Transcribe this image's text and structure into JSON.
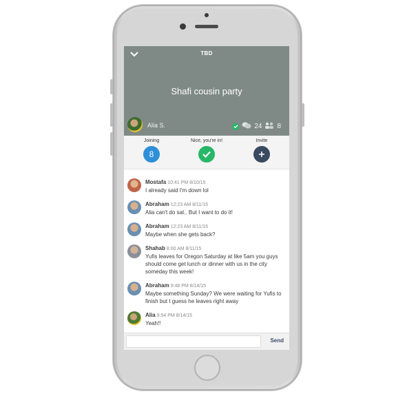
{
  "header": {
    "title": "TBD",
    "event_name": "Shafi cousin party",
    "host_name": "Alia S.",
    "comment_count": "24",
    "people_count": "8"
  },
  "actions": [
    {
      "label": "Joining",
      "value": "8",
      "color": "#2f8fd8"
    },
    {
      "label": "Nice, you're in!",
      "color": "#27b768",
      "icon": "check-icon"
    },
    {
      "label": "Invite",
      "color": "#3a4a5f",
      "icon": "plus-icon"
    }
  ],
  "messages": [
    {
      "name": "Mostafa",
      "time": "10:41 PM 8/10/15",
      "text": "I already said I'm down lol",
      "avatar_color": "#c0654a"
    },
    {
      "name": "Abraham",
      "time": "12:23 AM 8/11/15",
      "text": "Alia can't do sat.. But I want to do it!",
      "avatar_color": "#6a8fb3"
    },
    {
      "name": "Abraham",
      "time": "12:23 AM 8/11/15",
      "text": "Maybe when she gets back?",
      "avatar_color": "#6a8fb3"
    },
    {
      "name": "Shahab",
      "time": "8:00 AM 8/11/15",
      "text": "Yufis leaves for Oregon Saturday at like 5am you guys should come get lunch or dinner with us in the city someday this week!",
      "avatar_color": "#8a8f99"
    },
    {
      "name": "Abraham",
      "time": "9:48 PM 8/14/15",
      "text": "Maybe something Sunday? We were waiting for Yufis to finish but I guess he leaves right away",
      "avatar_color": "#6a8fb3"
    },
    {
      "name": "Alia",
      "time": "9:54 PM 8/14/15",
      "text": "Yeah!!",
      "avatar_color": "#4f7a35"
    }
  ],
  "composer": {
    "placeholder": "",
    "send_label": "Send"
  },
  "colors": {
    "header_bg": "#7f8a87",
    "accent_green": "#27b768",
    "accent_blue": "#2f8fd8",
    "accent_navy": "#3a4a5f"
  }
}
